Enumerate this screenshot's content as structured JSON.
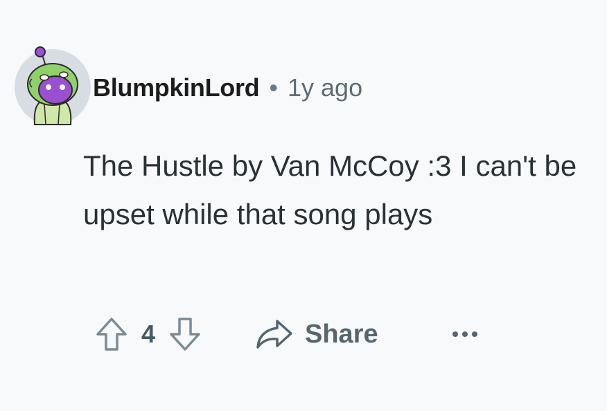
{
  "comment": {
    "author": "BlumpkinLord",
    "separator": "•",
    "time": "1y ago",
    "text": "The Hustle by Van McCoy :3 I can't be upset while that song plays"
  },
  "actions": {
    "upvote_icon": "upvote-arrow-icon",
    "score": "4",
    "downvote_icon": "downvote-arrow-icon",
    "share_icon": "share-arrow-icon",
    "share_label": "Share",
    "more_icon": "ellipsis-icon"
  },
  "colors": {
    "background": "#f8f9fb",
    "text": "#2a3135",
    "muted": "#5c6c77",
    "avatar_bg": "#d7dde3",
    "avatar_purple": "#9b4fd1",
    "avatar_green": "#8fd16a"
  }
}
